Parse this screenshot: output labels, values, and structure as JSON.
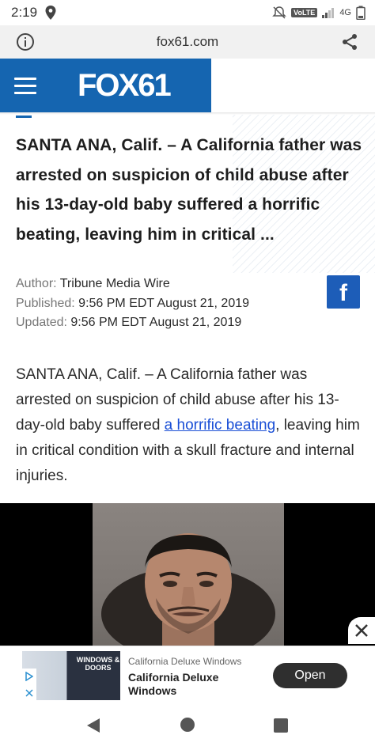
{
  "status_bar": {
    "time": "2:19",
    "volte": "VoLTE",
    "network": "4G"
  },
  "browser": {
    "url": "fox61.com"
  },
  "header": {
    "logo_text": "FOX61",
    "brand_color": "#1565b0"
  },
  "article": {
    "headline": "SANTA ANA, Calif. – A California father was arrested on suspicion of child abuse after his 13-day-old baby suffered a horrific beating, leaving him in critical ...",
    "author_label": "Author:",
    "author": "Tribune Media Wire",
    "published_label": "Published:",
    "published": "9:56 PM EDT August 21, 2019",
    "updated_label": "Updated:",
    "updated": "9:56 PM EDT August 21, 2019",
    "facebook_label": "f",
    "body_before_link": "SANTA ANA, Calif. – A California father was arrested on suspicion of child abuse after his 13-day-old baby suffered ",
    "body_link": "a horrific beating",
    "body_after_link": ", leaving him in critical condition with a skull fracture and internal injuries."
  },
  "ad": {
    "image_label": "WINDOWS & DOORS",
    "advertiser": "California Deluxe Windows",
    "title": "California Deluxe Windows",
    "cta": "Open"
  },
  "icons": {
    "location": "location-pin-icon",
    "info": "info-icon",
    "share": "share-icon",
    "menu": "hamburger-menu-icon",
    "close": "close-icon",
    "back": "back-triangle-icon",
    "home": "home-circle-icon",
    "recent": "recent-apps-square-icon"
  }
}
